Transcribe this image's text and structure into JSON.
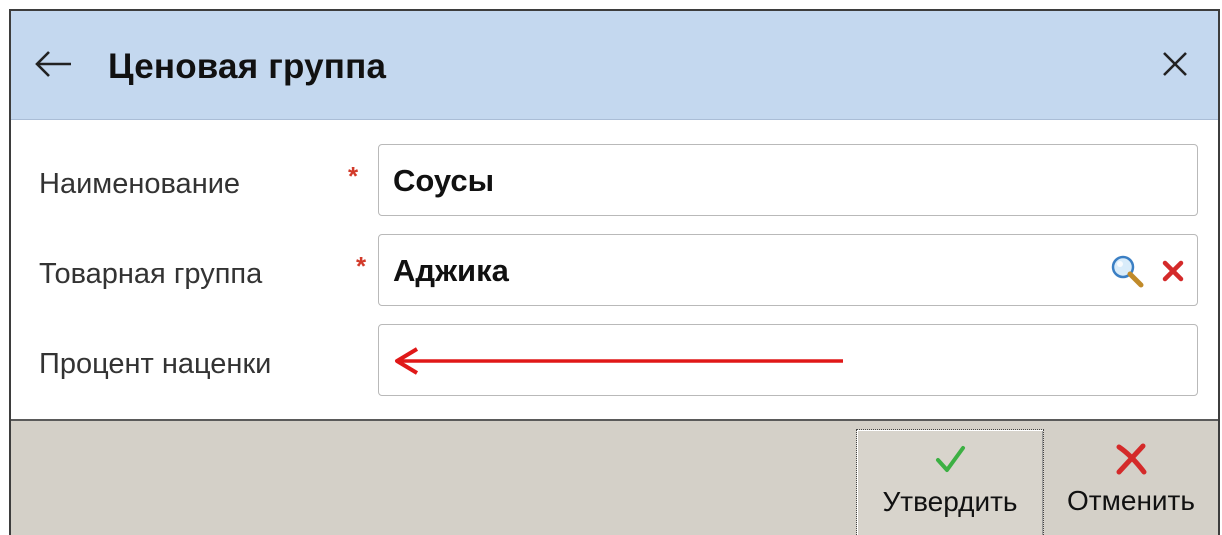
{
  "window": {
    "title": "Ценовая группа"
  },
  "form": {
    "name": {
      "label": "Наименование",
      "required_mark": "*",
      "value": "Соусы"
    },
    "product_group": {
      "label": "Товарная группа",
      "required_mark": "*",
      "value": "Аджика"
    },
    "markup_percent": {
      "label": "Процент наценки",
      "value": ""
    }
  },
  "buttons": {
    "confirm_label": "Утвердить",
    "cancel_label": "Отменить"
  },
  "icons": {
    "back": "arrow-left-icon",
    "close": "close-icon",
    "lookup": "magnifier-icon",
    "clear": "red-x-icon",
    "confirm": "green-check-icon",
    "cancel": "red-x-icon",
    "annotation": "red-arrow-left"
  },
  "colors": {
    "titlebar_bg": "#c4d8ef",
    "footer_bg": "#d4d0c8",
    "required_mark": "#d23a2a",
    "annotation_arrow": "#e01818",
    "confirm_check": "#3cb043",
    "cancel_x": "#d42a2a"
  }
}
